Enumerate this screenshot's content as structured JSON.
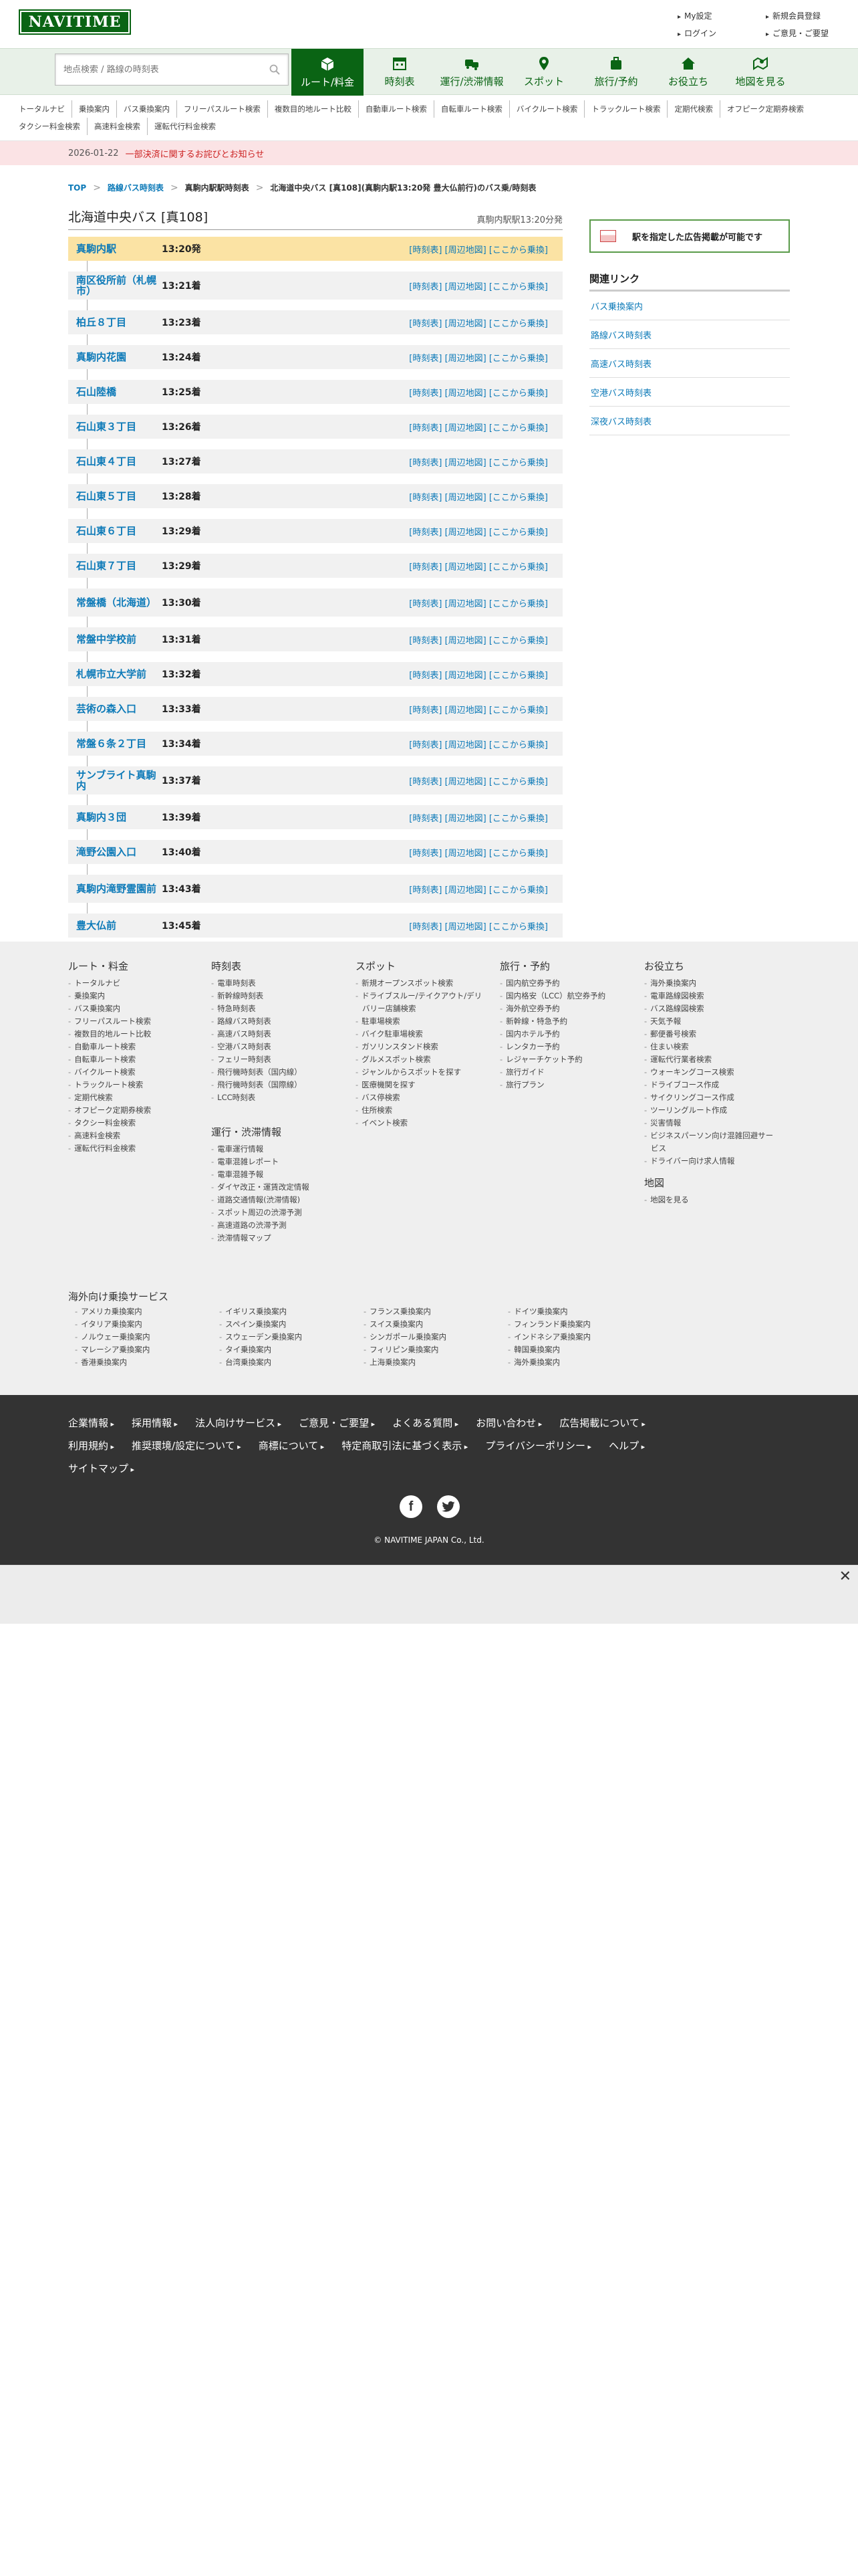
{
  "header": {
    "logo": "NAVITIME",
    "links_left": [
      "My設定",
      "ログイン"
    ],
    "links_right": [
      "新規会員登録",
      "ご意見・ご要望"
    ]
  },
  "search": {
    "placeholder": "地点検索 / 路線の時刻表"
  },
  "nav": {
    "tabs": [
      {
        "label": "ルート/料金",
        "icon": "car-icon"
      },
      {
        "label": "時刻表",
        "icon": "calendar-icon"
      },
      {
        "label": "運行/渋滞情報",
        "icon": "traffic-icon"
      },
      {
        "label": "スポット",
        "icon": "pin-icon"
      },
      {
        "label": "旅行/予約",
        "icon": "suitcase-icon"
      },
      {
        "label": "お役立ち",
        "icon": "house-icon"
      },
      {
        "label": "地図を見る",
        "icon": "map-icon"
      }
    ]
  },
  "subnav": [
    "トータルナビ",
    "乗換案内",
    "バス乗換案内",
    "フリーパスルート検索",
    "複数目的地ルート比較",
    "自動車ルート検索",
    "自転車ルート検索",
    "バイクルート検索",
    "トラックルート検索",
    "定期代検索",
    "オフピーク定期券検索",
    "タクシー料金検索",
    "高速料金検索",
    "運転代行料金検索"
  ],
  "notice": {
    "date": "2026-01-22",
    "message": "一部決済に関するお詫びとお知らせ"
  },
  "breadcrumb": {
    "top": "TOP",
    "level2": "路線バス時刻表",
    "level3": "真駒内駅駅時刻表",
    "current": "北海道中央バス [真108](真駒内駅13:20発 豊大仏前行)のバス乗/時刻表"
  },
  "page": {
    "title": "北海道中央バス [真108]",
    "subtitle": "真駒内駅駅13:20分発"
  },
  "stop_links": "[時刻表] [周辺地図] [ここから乗換]",
  "stops": [
    {
      "name": "真駒内駅",
      "time": "13:20発"
    },
    {
      "name": "南区役所前（札幌市）",
      "time": "13:21着"
    },
    {
      "name": "柏丘８丁目",
      "time": "13:23着"
    },
    {
      "name": "真駒内花園",
      "time": "13:24着"
    },
    {
      "name": "石山陸橋",
      "time": "13:25着"
    },
    {
      "name": "石山東３丁目",
      "time": "13:26着"
    },
    {
      "name": "石山東４丁目",
      "time": "13:27着"
    },
    {
      "name": "石山東５丁目",
      "time": "13:28着"
    },
    {
      "name": "石山東６丁目",
      "time": "13:29着"
    },
    {
      "name": "石山東７丁目",
      "time": "13:29着"
    },
    {
      "name": "常盤橋（北海道）",
      "time": "13:30着"
    },
    {
      "name": "常盤中学校前",
      "time": "13:31着"
    },
    {
      "name": "札幌市立大学前",
      "time": "13:32着"
    },
    {
      "name": "芸術の森入口",
      "time": "13:33着"
    },
    {
      "name": "常盤６条２丁目",
      "time": "13:34着"
    },
    {
      "name": "サンブライト真駒内",
      "time": "13:37着"
    },
    {
      "name": "真駒内３団",
      "time": "13:39着"
    },
    {
      "name": "滝野公園入口",
      "time": "13:40着"
    },
    {
      "name": "真駒内滝野霊園前",
      "time": "13:43着"
    },
    {
      "name": "豊大仏前",
      "time": "13:45着"
    }
  ],
  "sidebar": {
    "ad_button": "駅を指定した広告掲載が可能です",
    "related_title": "関連リンク",
    "related": [
      "バス乗換案内",
      "路線バス時刻表",
      "高速バス時刻表",
      "空港バス時刻表",
      "深夜バス時刻表"
    ]
  },
  "footer": {
    "cols": [
      {
        "title": "ルート・料金",
        "items": [
          "トータルナビ",
          "乗換案内",
          "バス乗換案内",
          "フリーパスルート検索",
          "複数目的地ルート比較",
          "自動車ルート検索",
          "自転車ルート検索",
          "バイクルート検索",
          "トラックルート検索",
          "定期代検索",
          "オフピーク定期券検索",
          "タクシー料金検索",
          "高速料金検索",
          "運転代行料金検索"
        ]
      },
      {
        "title": "時刻表",
        "items": [
          "電車時刻表",
          "新幹線時刻表",
          "特急時刻表",
          "路線バス時刻表",
          "高速バス時刻表",
          "空港バス時刻表",
          "フェリー時刻表",
          "飛行機時刻表（国内線）",
          "飛行機時刻表（国際線）",
          "LCC時刻表"
        ]
      },
      {
        "title": "運行・渋滞情報",
        "items": [
          "電車運行情報",
          "電車混雑レポート",
          "電車混雑予報",
          "ダイヤ改正・運賃改定情報",
          "道路交通情報(渋滞情報)",
          "スポット周辺の渋滞予測",
          "高速道路の渋滞予測",
          "渋滞情報マップ"
        ]
      },
      {
        "title": "スポット",
        "items": [
          "新規オープンスポット検索",
          "ドライブスルー/テイクアウト/デリバリー店舗検索",
          "駐車場検索",
          "バイク駐車場検索",
          "ガソリンスタンド検索",
          "グルメスポット検索",
          "ジャンルからスポットを探す",
          "医療機関を探す",
          "バス停検索",
          "住所検索",
          "イベント検索"
        ]
      },
      {
        "title": "旅行・予約",
        "items": [
          "国内航空券予約",
          "国内格安（LCC）航空券予約",
          "海外航空券予約",
          "新幹線・特急予約",
          "国内ホテル予約",
          "レンタカー予約",
          "レジャーチケット予約",
          "旅行ガイド",
          "旅行プラン"
        ]
      },
      {
        "title": "お役立ち",
        "items": [
          "海外乗換案内",
          "電車路線図検索",
          "バス路線図検索",
          "天気予報",
          "郵便番号検索",
          "住まい検索",
          "運転代行業者検索",
          "ウォーキングコース検索",
          "ドライブコース作成",
          "サイクリングコース作成",
          "ツーリングルート作成",
          "災害情報",
          "ビジネスパーソン向け混雑回避サービス",
          "ドライバー向け求人情報"
        ]
      },
      {
        "title": "地図",
        "items": [
          "地図を見る"
        ]
      }
    ],
    "overseas_title": "海外向け乗換サービス",
    "overseas": [
      [
        "アメリカ乗換案内",
        "イタリア乗換案内",
        "ノルウェー乗換案内",
        "マレーシア乗換案内",
        "香港乗換案内"
      ],
      [
        "イギリス乗換案内",
        "スペイン乗換案内",
        "スウェーデン乗換案内",
        "タイ乗換案内",
        "台湾乗換案内"
      ],
      [
        "フランス乗換案内",
        "スイス乗換案内",
        "シンガポール乗換案内",
        "フィリピン乗換案内",
        "上海乗換案内"
      ],
      [
        "ドイツ乗換案内",
        "フィンランド乗換案内",
        "インドネシア乗換案内",
        "韓国乗換案内",
        "海外乗換案内"
      ]
    ],
    "dark_links": [
      "企業情報",
      "採用情報",
      "法人向けサービス",
      "ご意見・ご要望",
      "よくある質問",
      "お問い合わせ",
      "広告掲載について",
      "利用規約",
      "推奨環境/設定について",
      "商標について",
      "特定商取引法に基づく表示",
      "プライバシーポリシー",
      "ヘルプ",
      "サイトマップ"
    ],
    "copyright": "© NAVITIME JAPAN Co., Ltd."
  },
  "colors": {
    "brand": "#0a6414",
    "link": "#0d7ab8",
    "highlight": "#fbe3a4",
    "notice_bg": "#fbe3e5"
  }
}
